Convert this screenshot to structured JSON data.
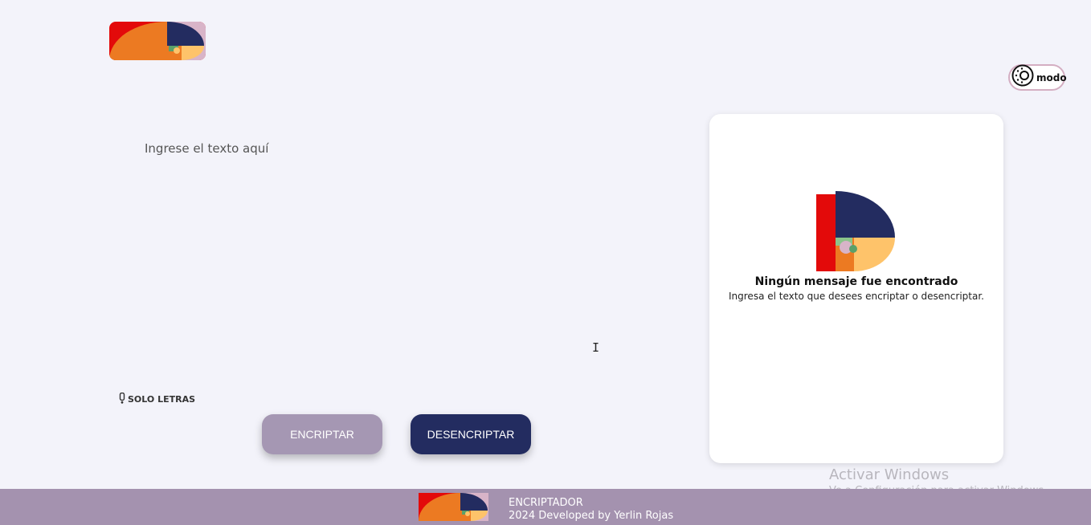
{
  "header": {
    "logo": "golden-spiral-logo"
  },
  "mode_toggle": {
    "label": "modo",
    "icon": "sun-icon"
  },
  "input": {
    "placeholder": "Ingrese el texto aquí",
    "value": ""
  },
  "hint": {
    "icon": "exclamation-icon",
    "text": "SOLO LETRAS"
  },
  "buttons": {
    "encrypt": "ENCRIPTAR",
    "decrypt": "DESENCRIPTAR"
  },
  "output_panel": {
    "illustration": "golden-spiral-illustration",
    "title": "Ningún mensaje fue encontrado",
    "subtitle": "Ingresa el texto que desees encriptar o desencriptar."
  },
  "watermark": {
    "title": "Activar Windows",
    "subtitle": "Ve a Configuración para activar Windows."
  },
  "footer": {
    "app_name": "ENCRIPTADOR",
    "credit": "2024 Developed by Yerlin Rojas"
  },
  "colors": {
    "background": "#f3f3fa",
    "navy": "#232c60",
    "lilac": "#a597b3",
    "footer": "#a492af",
    "red": "#e30a0a",
    "orange": "#ec7a22",
    "peach": "#fec36a",
    "pink": "#d8b4c8"
  }
}
